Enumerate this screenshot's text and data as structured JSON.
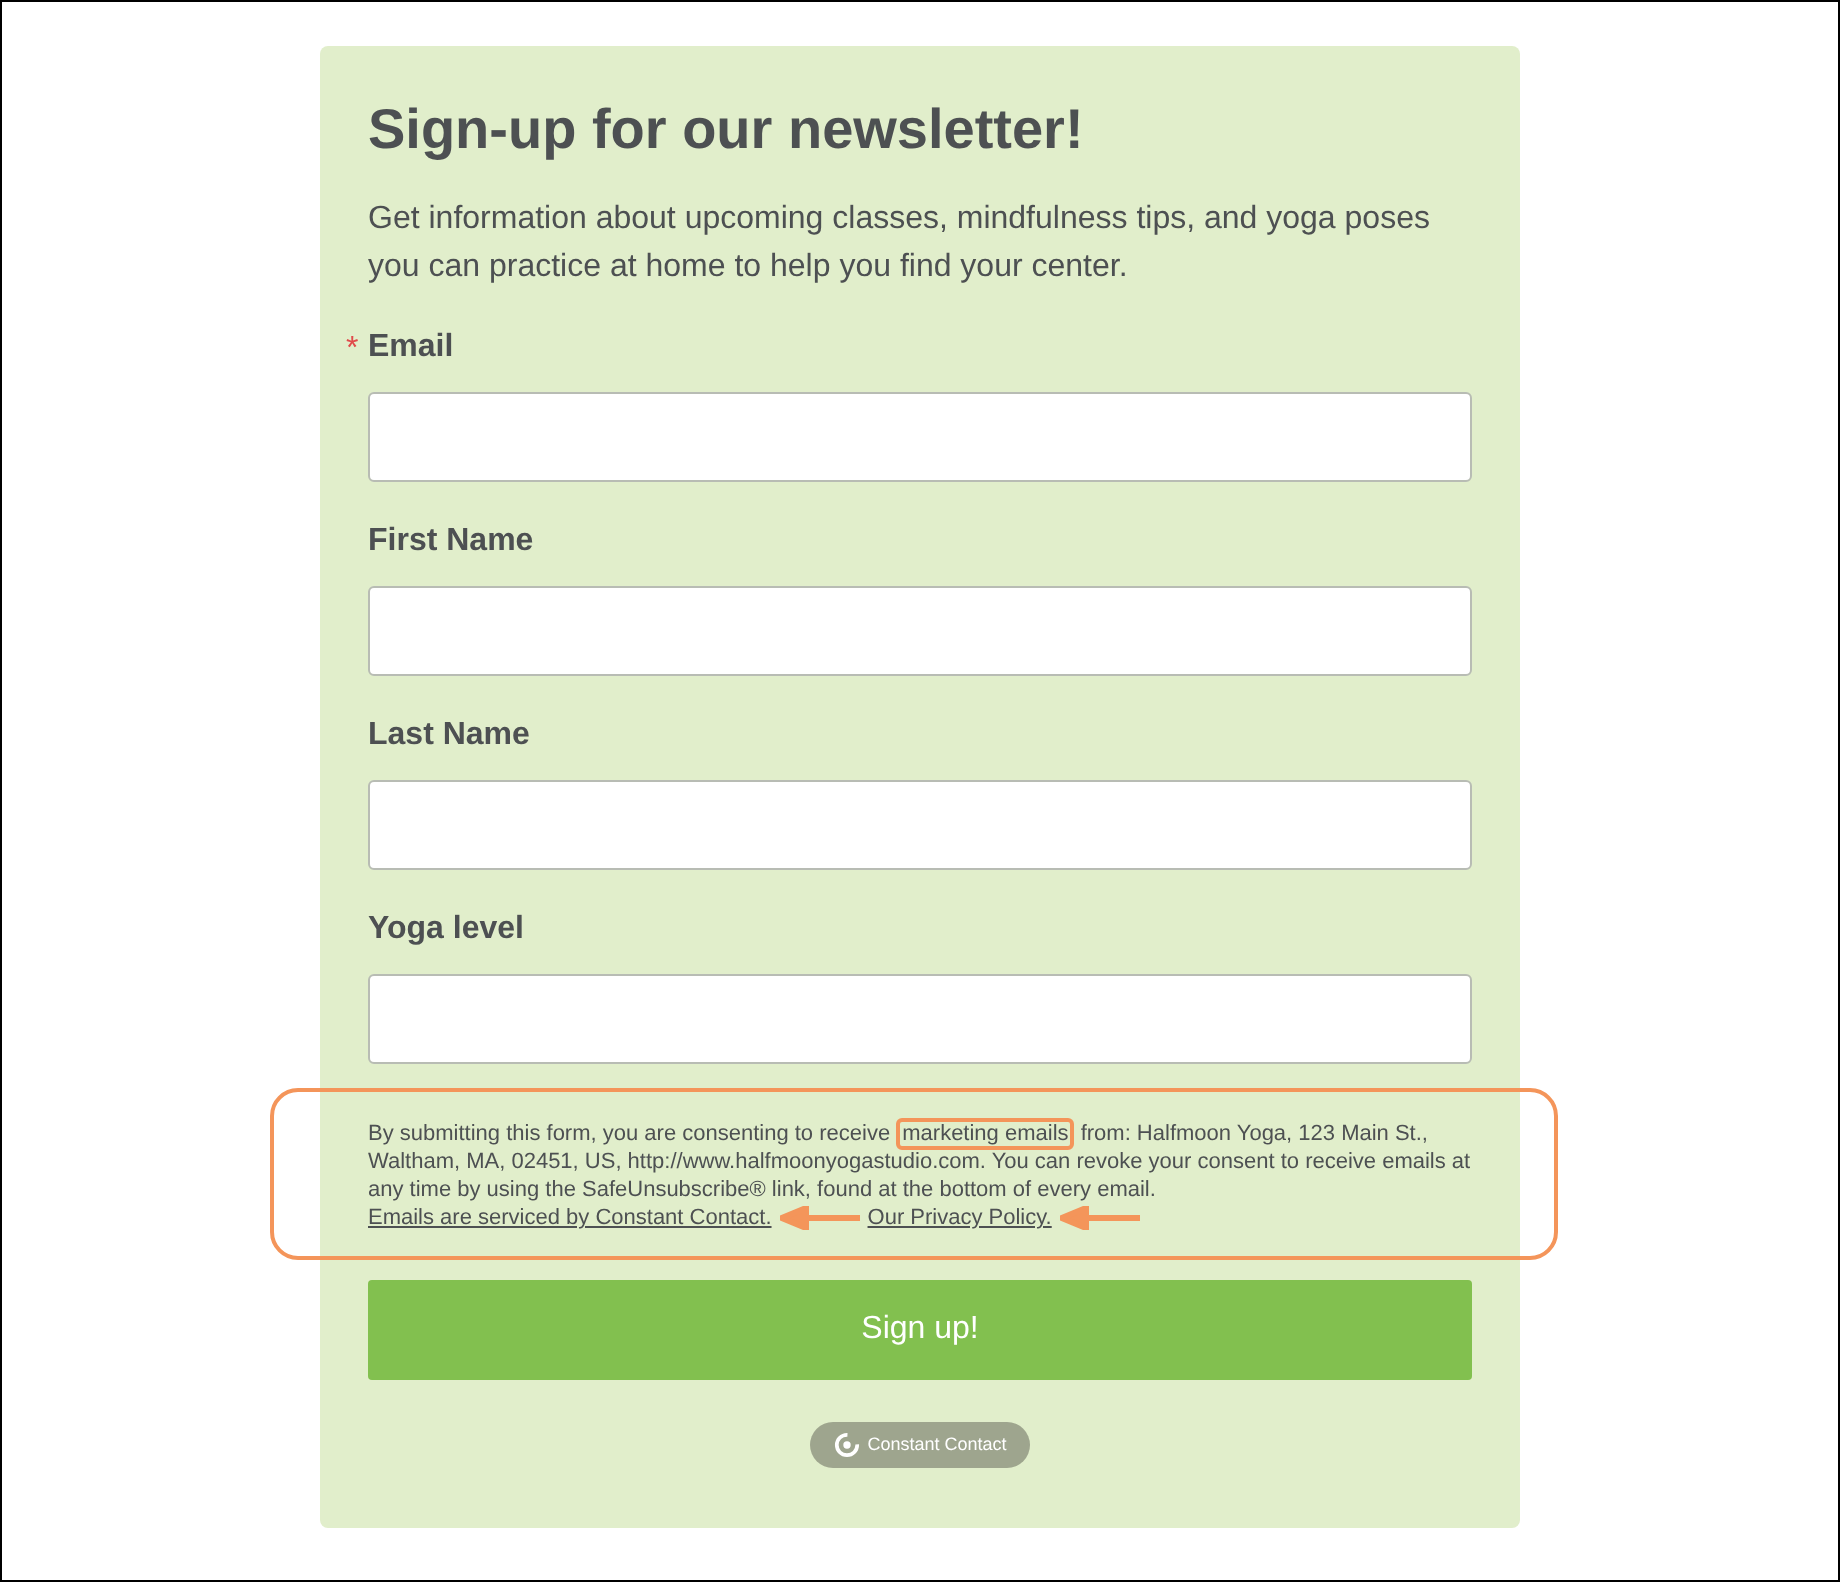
{
  "form": {
    "title": "Sign-up for our newsletter!",
    "intro": "Get information about upcoming classes, mindfulness tips, and yoga poses you can practice at home to help you find your center.",
    "required_marker": "*",
    "fields": [
      {
        "label": "Email",
        "required": true
      },
      {
        "label": "First Name",
        "required": false
      },
      {
        "label": "Last Name",
        "required": false
      },
      {
        "label": "Yoga level",
        "required": false
      }
    ],
    "consent": {
      "annotated": true,
      "parts": [
        {
          "kind": "text",
          "text": "By submitting this form, you are consenting to receive "
        },
        {
          "kind": "highlight",
          "text": "marketing emails"
        },
        {
          "kind": "text",
          "text": " from: Halfmoon Yoga, 123 Main St., Waltham, MA, 02451, US, http://www.halfmoonyogastudio.com. You can revoke your consent to receive emails at any time by using the SafeUnsubscribe® link, found at the bottom of every email. "
        },
        {
          "kind": "link",
          "text": "Emails are serviced by Constant Contact.",
          "arrow": true
        },
        {
          "kind": "link",
          "text": "Our Privacy Policy.",
          "arrow": true
        }
      ]
    },
    "submit": "Sign up!",
    "badge": "Constant Contact"
  }
}
